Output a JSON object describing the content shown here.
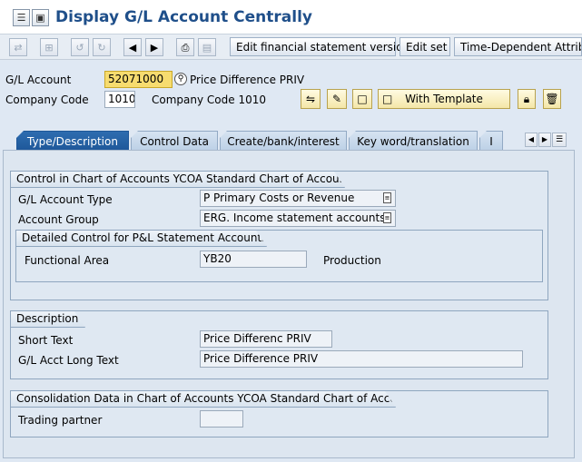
{
  "title": "Display G/L Account Centrally",
  "toolbar": {
    "edit_fs_version": "Edit financial statement version",
    "edit_set": "Edit set",
    "time_dependent": "Time-Dependent Attribu"
  },
  "header": {
    "gl_account_label": "G/L Account",
    "gl_account_value": "52071000",
    "gl_account_desc": "Price Difference PRIV",
    "company_code_label": "Company Code",
    "company_code_value": "1010",
    "company_code_desc": "Company Code 1010",
    "with_template_label": "With Template"
  },
  "tabs": [
    {
      "label": "Type/Description"
    },
    {
      "label": "Control Data"
    },
    {
      "label": "Create/bank/interest"
    },
    {
      "label": "Key word/translation"
    },
    {
      "label": "I"
    }
  ],
  "control_group": {
    "title": "Control in Chart of Accounts YCOA Standard Chart of Accounts",
    "gl_type_label": "G/L Account Type",
    "gl_type_value": "P Primary Costs or Revenue",
    "account_group_label": "Account Group",
    "account_group_value": "ERG. Income statement accounts"
  },
  "pl_group": {
    "title": "Detailed Control for P&L Statement Accounts",
    "functional_area_label": "Functional Area",
    "functional_area_value": "YB20",
    "functional_area_desc": "Production"
  },
  "description_group": {
    "title": "Description",
    "short_text_label": "Short Text",
    "short_text_value": "Price Differenc PRIV",
    "long_text_label": "G/L Acct Long Text",
    "long_text_value": "Price Difference PRIV"
  },
  "consolidation_group": {
    "title": "Consolidation Data in Chart of Accounts YCOA Standard Chart of Accounts",
    "trading_partner_label": "Trading partner",
    "trading_partner_value": ""
  },
  "icons": [
    "menu-icon",
    "save-icon",
    "back-icon",
    "previous-icon",
    "next-icon",
    "print-icon",
    "document-icon",
    "display-change-icon",
    "edit-pencil-icon",
    "create-icon",
    "lock-icon",
    "delete-icon",
    "search-help-icon"
  ]
}
